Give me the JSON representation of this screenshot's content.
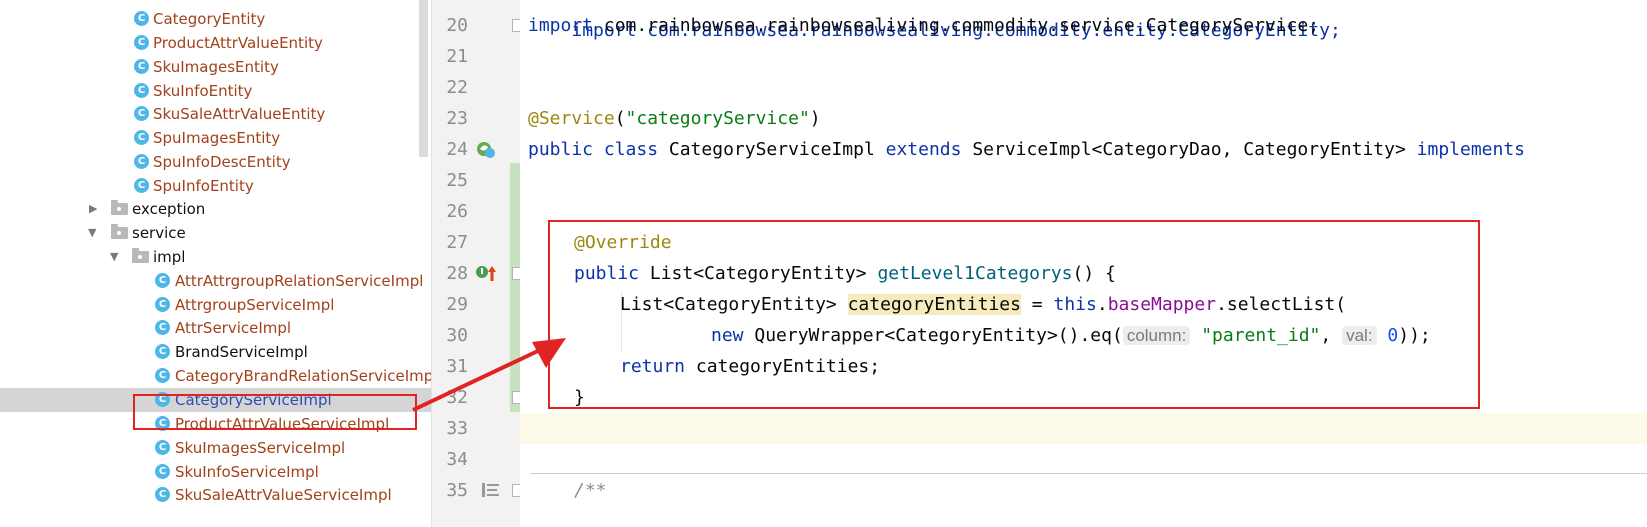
{
  "tree": {
    "items": [
      {
        "label": "CategoryEntity",
        "kind": "class",
        "color": "red"
      },
      {
        "label": "ProductAttrValueEntity",
        "kind": "class",
        "color": "red"
      },
      {
        "label": "SkuImagesEntity",
        "kind": "class",
        "color": "red"
      },
      {
        "label": "SkuInfoEntity",
        "kind": "class",
        "color": "red"
      },
      {
        "label": "SkuSaleAttrValueEntity",
        "kind": "class",
        "color": "red"
      },
      {
        "label": "SpuImagesEntity",
        "kind": "class",
        "color": "red"
      },
      {
        "label": "SpuInfoDescEntity",
        "kind": "class",
        "color": "red"
      },
      {
        "label": "SpuInfoEntity",
        "kind": "class",
        "color": "red"
      },
      {
        "label": "exception",
        "kind": "package",
        "expanded": false
      },
      {
        "label": "service",
        "kind": "package",
        "expanded": true
      },
      {
        "label": "impl",
        "kind": "package",
        "expanded": true
      },
      {
        "label": "AttrAttrgroupRelationServiceImpl",
        "kind": "class",
        "color": "red"
      },
      {
        "label": "AttrgroupServiceImpl",
        "kind": "class",
        "color": "red"
      },
      {
        "label": "AttrServiceImpl",
        "kind": "class",
        "color": "red"
      },
      {
        "label": "BrandServiceImpl",
        "kind": "class",
        "color": "black"
      },
      {
        "label": "CategoryBrandRelationServiceImp",
        "kind": "class",
        "color": "red"
      },
      {
        "label": "CategoryServiceImpl",
        "kind": "class",
        "color": "blue",
        "selected": true
      },
      {
        "label": "ProductAttrValueServiceImpl",
        "kind": "class",
        "color": "red"
      },
      {
        "label": "SkuImagesServiceImpl",
        "kind": "class",
        "color": "red"
      },
      {
        "label": "SkuInfoServiceImpl",
        "kind": "class",
        "color": "red"
      },
      {
        "label": "SkuSaleAttrValueServiceImpl",
        "kind": "class",
        "color": "red"
      }
    ]
  },
  "editor": {
    "line_numbers": [
      "20",
      "21",
      "22",
      "23",
      "24",
      "25",
      "26",
      "27",
      "28",
      "29",
      "30",
      "31",
      "32",
      "33",
      "34",
      "35"
    ],
    "current_line": "33",
    "code": {
      "l19": "import com.rainbowsea.rainbowsealiving.commodity.entity.CategoryEntity;",
      "l20_kw": "import",
      "l20_rest": " com.rainbowsea.rainbowsealiving.commodity.service.CategoryService;",
      "l23_ann": "@Service",
      "l23_open": "(",
      "l23_str": "\"categoryService\"",
      "l23_close": ")",
      "l24_kw1": "public class",
      "l24_name": " CategoryServiceImpl ",
      "l24_kw2": "extends",
      "l24_super": " ServiceImpl<CategoryDao, CategoryEntity> ",
      "l24_kw3": "implements",
      "l27_ann": "@Override",
      "l28_kw": "public",
      "l28_type": " List<CategoryEntity> ",
      "l28_meth": "getLevel1Categorys",
      "l28_rest": "() {",
      "l29_type": "List<CategoryEntity> ",
      "l29_var": "categoryEntities",
      "l29_eq": " = ",
      "l29_this": "this",
      "l29_dot": ".",
      "l29_fld": "baseMapper",
      "l29_call": ".selectList(",
      "l30_new": "new",
      "l30_mid": " QueryWrapper<CategoryEntity>().eq(",
      "l30_hint1": "column:",
      "l30_str": "\"parent_id\"",
      "l30_comma": ", ",
      "l30_hint2": "val:",
      "l30_num": "0",
      "l30_end": "));",
      "l31_kw": "return",
      "l31_rest": " categoryEntities;",
      "l32": "}",
      "l35": "/**"
    }
  },
  "colors": {
    "annotation_box": "#e02424",
    "selected_row": "#d5d5d5",
    "class_icon": "#4fb6e8"
  }
}
